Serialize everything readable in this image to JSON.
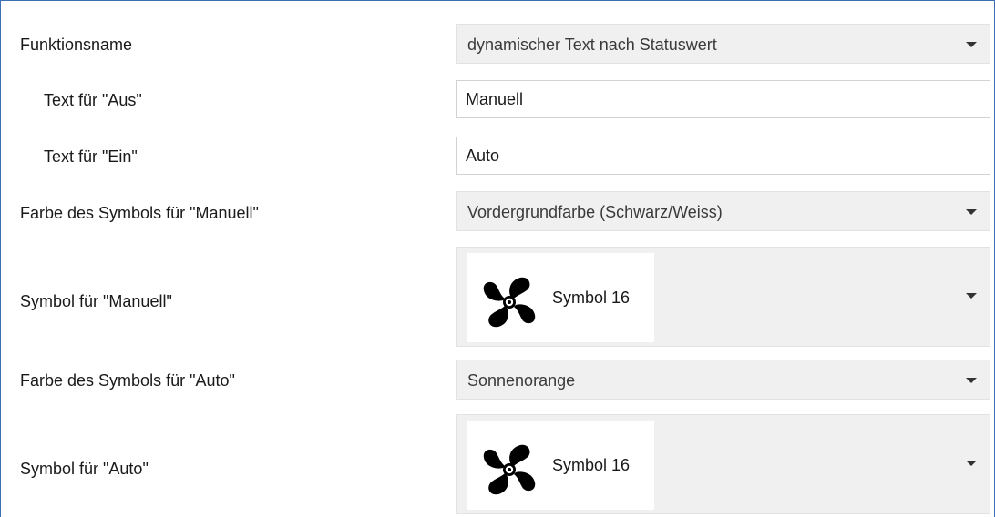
{
  "rows": {
    "funktionsname": {
      "label": "Funktionsname",
      "value": "dynamischer Text nach Statuswert",
      "arrow_icon": "chevron-down-icon"
    },
    "text_aus": {
      "label": "Text für \"Aus\"",
      "value": "Manuell"
    },
    "text_ein": {
      "label": "Text für \"Ein\"",
      "value": "Auto"
    },
    "farbe_manuell": {
      "label": "Farbe des Symbols für \"Manuell\"",
      "value": "Vordergrundfarbe (Schwarz/Weiss)",
      "arrow_icon": "chevron-down-icon"
    },
    "symbol_manuell": {
      "label": "Symbol für \"Manuell\"",
      "value": "Symbol 16",
      "icon": "fan-icon",
      "arrow_icon": "chevron-down-icon"
    },
    "farbe_auto": {
      "label": "Farbe des Symbols für \"Auto\"",
      "value": "Sonnenorange",
      "arrow_icon": "chevron-down-icon"
    },
    "symbol_auto": {
      "label": "Symbol für \"Auto\"",
      "value": "Symbol 16",
      "icon": "fan-icon",
      "arrow_icon": "chevron-down-icon"
    }
  },
  "colors": {
    "border_accent": "#3c6fb4",
    "select_background": "#f0f0f0"
  }
}
